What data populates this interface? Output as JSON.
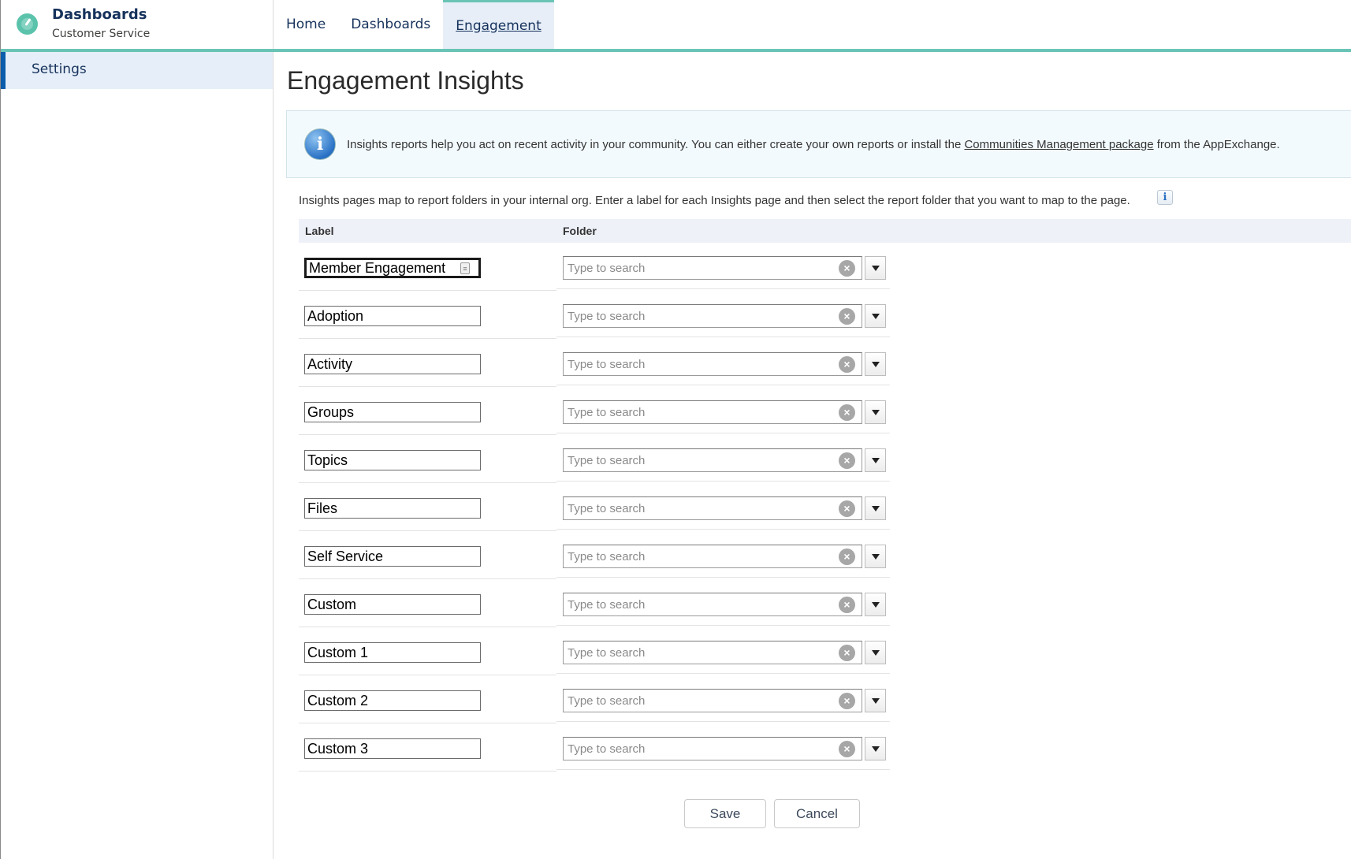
{
  "app": {
    "title": "Dashboards",
    "subtitle": "Customer Service",
    "accent": "#6ac4b6"
  },
  "nav": {
    "tabs": [
      {
        "label": "Home",
        "active": false
      },
      {
        "label": "Dashboards",
        "active": false
      },
      {
        "label": "Engagement",
        "active": true
      }
    ]
  },
  "sidebar": {
    "items": [
      {
        "label": "Settings",
        "active": true
      }
    ]
  },
  "page": {
    "title": "Engagement Insights",
    "banner": {
      "text_before": "Insights reports help you act on recent activity in your community. You can either create your own reports or install the ",
      "link": "Communities Management package",
      "text_after": " from the AppExchange."
    },
    "intro": "Insights pages map to report folders in your internal org. Enter a label for each Insights page and then select the report folder that you want to map to the page.",
    "help_icon": "i"
  },
  "table": {
    "headers": {
      "label": "Label",
      "folder": "Folder"
    },
    "folder_placeholder": "Type to search",
    "rows": [
      {
        "label": "Member Engagement",
        "folder": ""
      },
      {
        "label": "Adoption",
        "folder": ""
      },
      {
        "label": "Activity",
        "folder": ""
      },
      {
        "label": "Groups",
        "folder": ""
      },
      {
        "label": "Topics",
        "folder": ""
      },
      {
        "label": "Files",
        "folder": ""
      },
      {
        "label": "Self Service",
        "folder": ""
      },
      {
        "label": "Custom",
        "folder": ""
      },
      {
        "label": "Custom 1",
        "folder": ""
      },
      {
        "label": "Custom 2",
        "folder": ""
      },
      {
        "label": "Custom 3",
        "folder": ""
      }
    ]
  },
  "actions": {
    "save": "Save",
    "cancel": "Cancel"
  }
}
